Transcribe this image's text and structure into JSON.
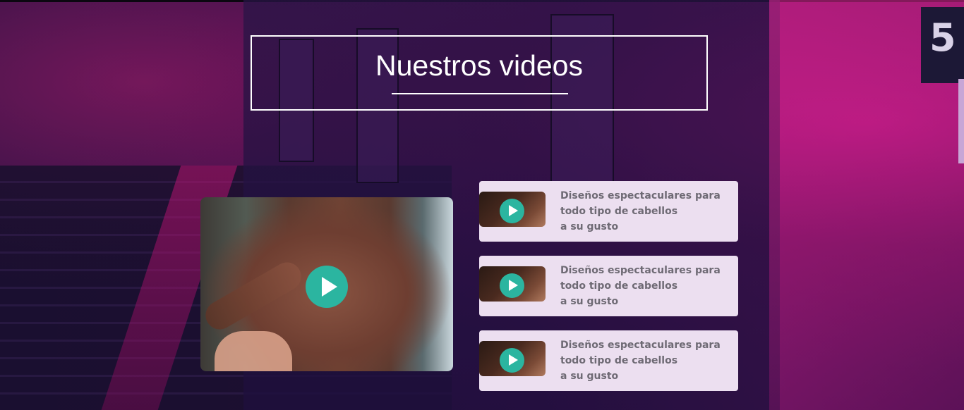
{
  "section": {
    "title": "Nuestros videos"
  },
  "background": {
    "car_number": "5"
  },
  "main_video": {
    "play_icon": "play-icon"
  },
  "video_list": [
    {
      "line1": "Diseños espectaculares para",
      "line2": "todo tipo de cabellos",
      "line3": "a su gusto"
    },
    {
      "line1": "Diseños espectaculares para",
      "line2": "todo tipo de cabellos",
      "line3": "a su gusto"
    },
    {
      "line1": "Diseños espectaculares para",
      "line2": "todo tipo de cabellos",
      "line3": "a su gusto"
    }
  ],
  "colors": {
    "accent_play": "#2bb5a0",
    "card_background": "#ecdff0",
    "card_text": "#6e6a74",
    "title_text": "#ffffff"
  }
}
